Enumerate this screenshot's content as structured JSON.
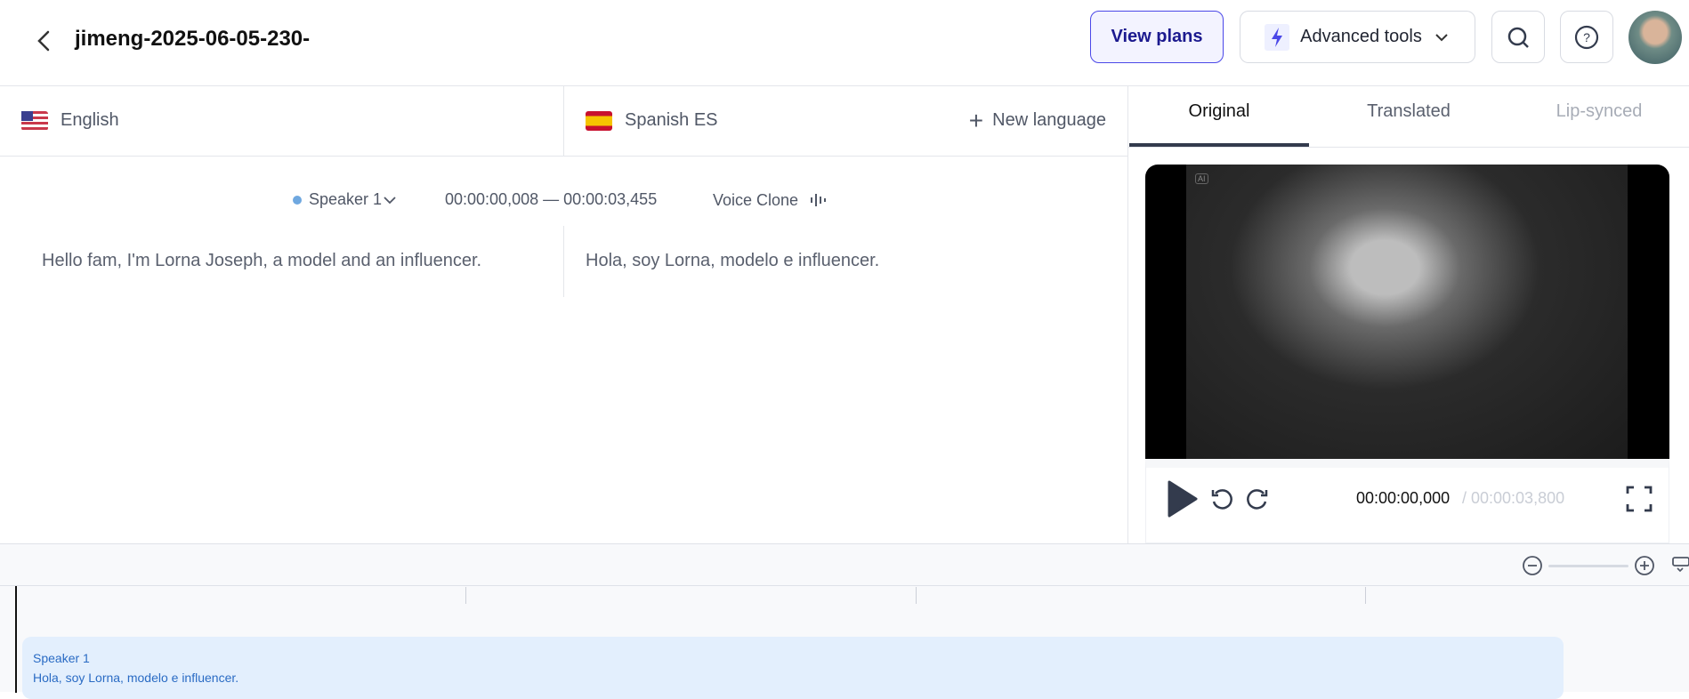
{
  "header": {
    "title": "jimeng-2025-06-05-230-",
    "view_plans": "View plans",
    "advanced_tools": "Advanced tools"
  },
  "languages": {
    "source": "English",
    "target": "Spanish ES",
    "new_language": "New language"
  },
  "tabs": [
    "Original",
    "Translated",
    "Lip-synced"
  ],
  "segment": {
    "speaker": "Speaker 1",
    "time_range": "00:00:00,008 — 00:00:03,455",
    "voice": "Voice Clone",
    "source_text": "Hello fam, I'm Lorna Joseph, a model and an influencer.",
    "target_text": "Hola, soy Lorna, modelo e influencer."
  },
  "player": {
    "current": "00:00:00,000",
    "total": "/ 00:00:03,800",
    "ai_badge": "AI"
  },
  "timeline": {
    "speaker": "Speaker 1",
    "text": "Hola, soy Lorna, modelo e influencer."
  },
  "colors": {
    "accent": "#4b48e8",
    "segment": "#e3effd"
  }
}
